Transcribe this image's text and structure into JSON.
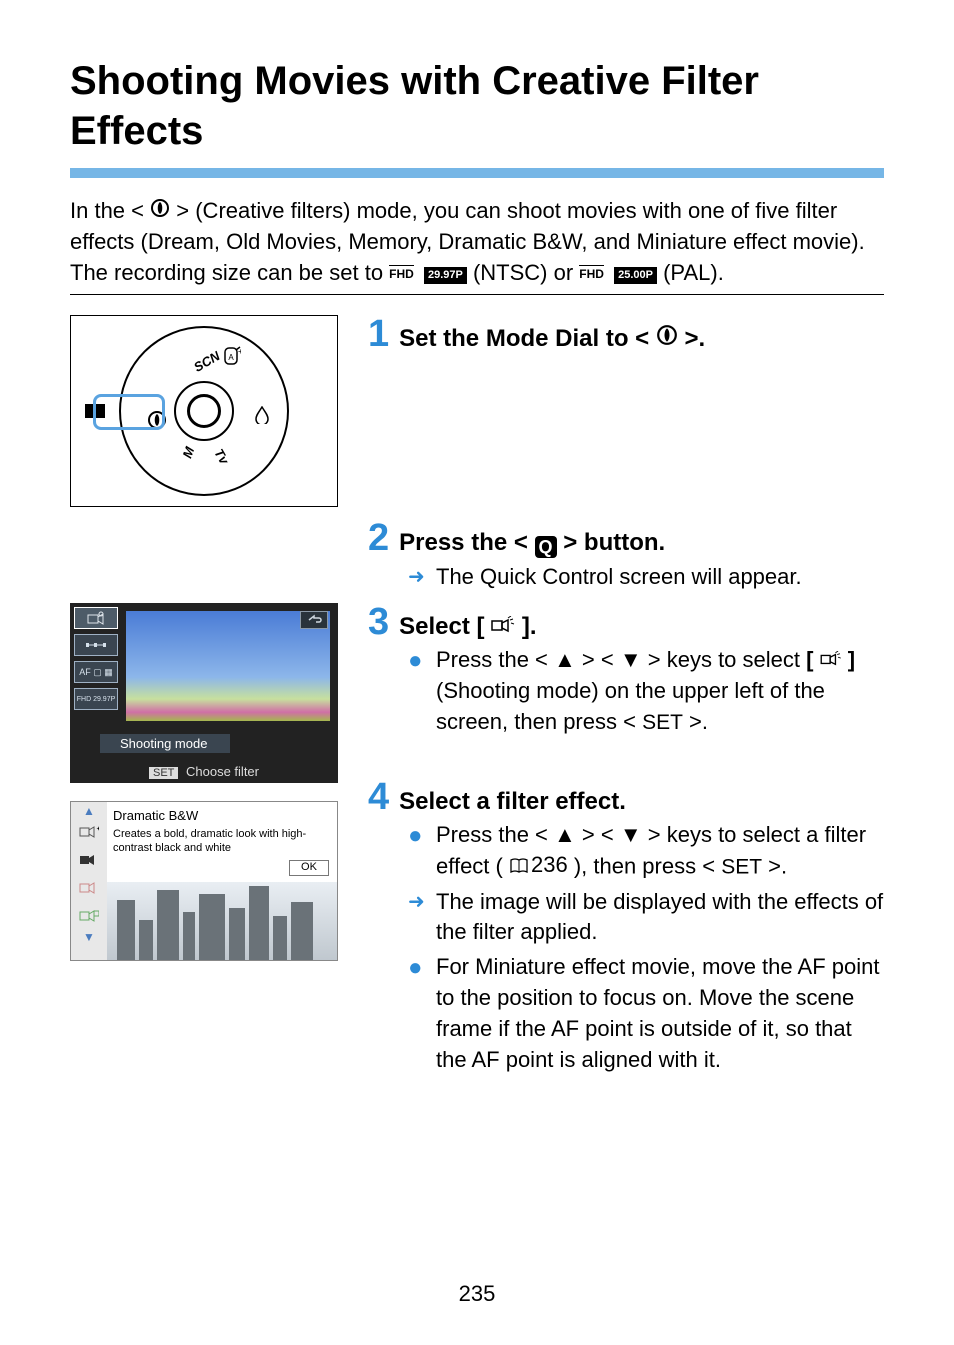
{
  "page": {
    "title": "Shooting Movies with Creative Filter Effects",
    "number": "235"
  },
  "intro": {
    "line1a": "In the <",
    "line1b": "> (Creative filters) mode, you can shoot movies with one of five filter effects (Dream, Old Movies, Memory, Dramatic B&W, and Miniature effect movie).",
    "line2a": "The recording size can be set to ",
    "ntsc_fhd": "FHD",
    "ntsc_fps": "29.97P",
    "ntsc_txt": " (NTSC) or ",
    "pal_fhd": "FHD",
    "pal_fps": "25.00P",
    "pal_txt": " (PAL)."
  },
  "dial": {
    "scn": "SCN",
    "tv": "Tv",
    "m": "M"
  },
  "steps": {
    "s1": {
      "num": "1",
      "title_a": "Set the Mode Dial to <",
      "title_b": ">."
    },
    "s2": {
      "num": "2",
      "title_a": "Press the <",
      "title_b": "> button.",
      "sub1": "The Quick Control screen will appear."
    },
    "s3": {
      "num": "3",
      "title_a": "Select [",
      "title_b": "].",
      "sub1_a": "Press the <",
      "sub1_b": "> <",
      "sub1_c": "> keys to select ",
      "sub1_d": " (Shooting mode) on the upper left of the screen, then press <",
      "sub1_e": ">.",
      "icon_sel_a": "[",
      "icon_sel_b": "]"
    },
    "s4": {
      "num": "4",
      "title": "Select a filter effect.",
      "sub1_a": "Press the <",
      "sub1_b": "> <",
      "sub1_c": "> keys to select a filter effect (",
      "sub1_page": "236",
      "sub1_d": "), then press <",
      "sub1_e": ">.",
      "sub2": "The image will be displayed with the effects of the filter applied.",
      "sub3": "For Miniature effect movie, move the AF point to the position to focus on. Move the scene frame if the AF point is outside of it, so that the AF point is aligned with it."
    }
  },
  "shot1": {
    "icon_af": "AF ▢ ▦",
    "icon_fhd": "FHD 29.97P",
    "label": "Shooting mode",
    "set": "SET",
    "choose": "Choose filter"
  },
  "shot2": {
    "title": "Dramatic B&W",
    "desc": "Creates a bold, dramatic look with high-contrast black and white",
    "ok": "OK"
  }
}
